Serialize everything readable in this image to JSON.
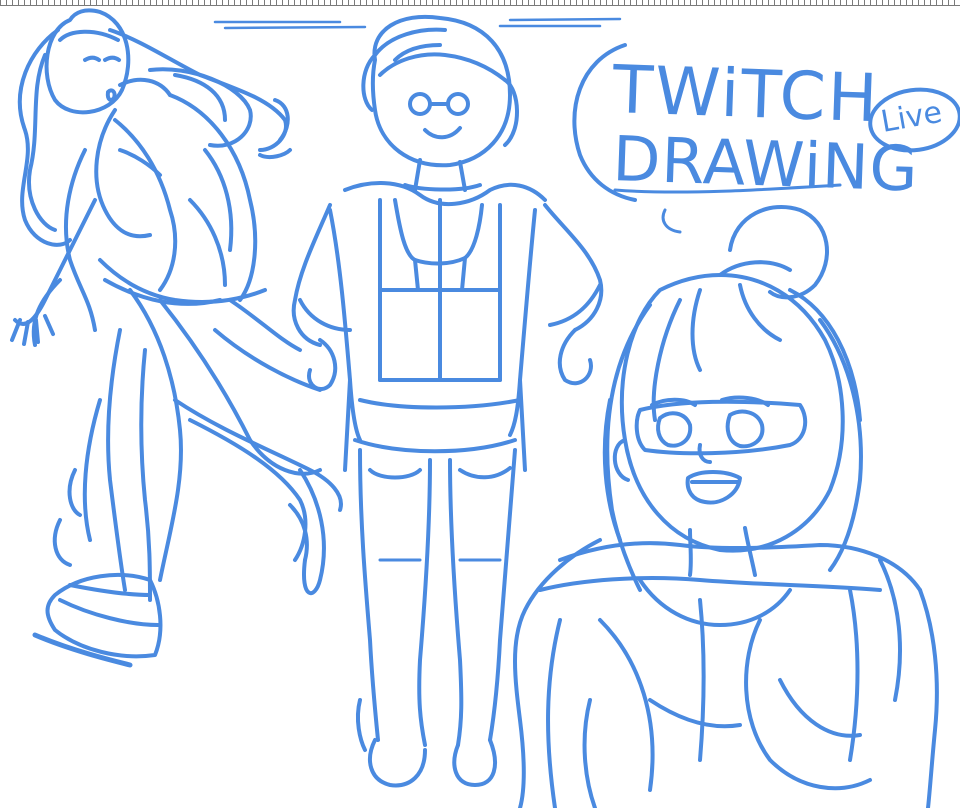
{
  "canvas": {
    "stroke_color": "#4a8ae0",
    "background": "#ffffff",
    "ruler_color": "#6f6f6f"
  },
  "title": {
    "line1": "TWiTCH",
    "line2": "DRAWiNG",
    "badge": "Live"
  }
}
